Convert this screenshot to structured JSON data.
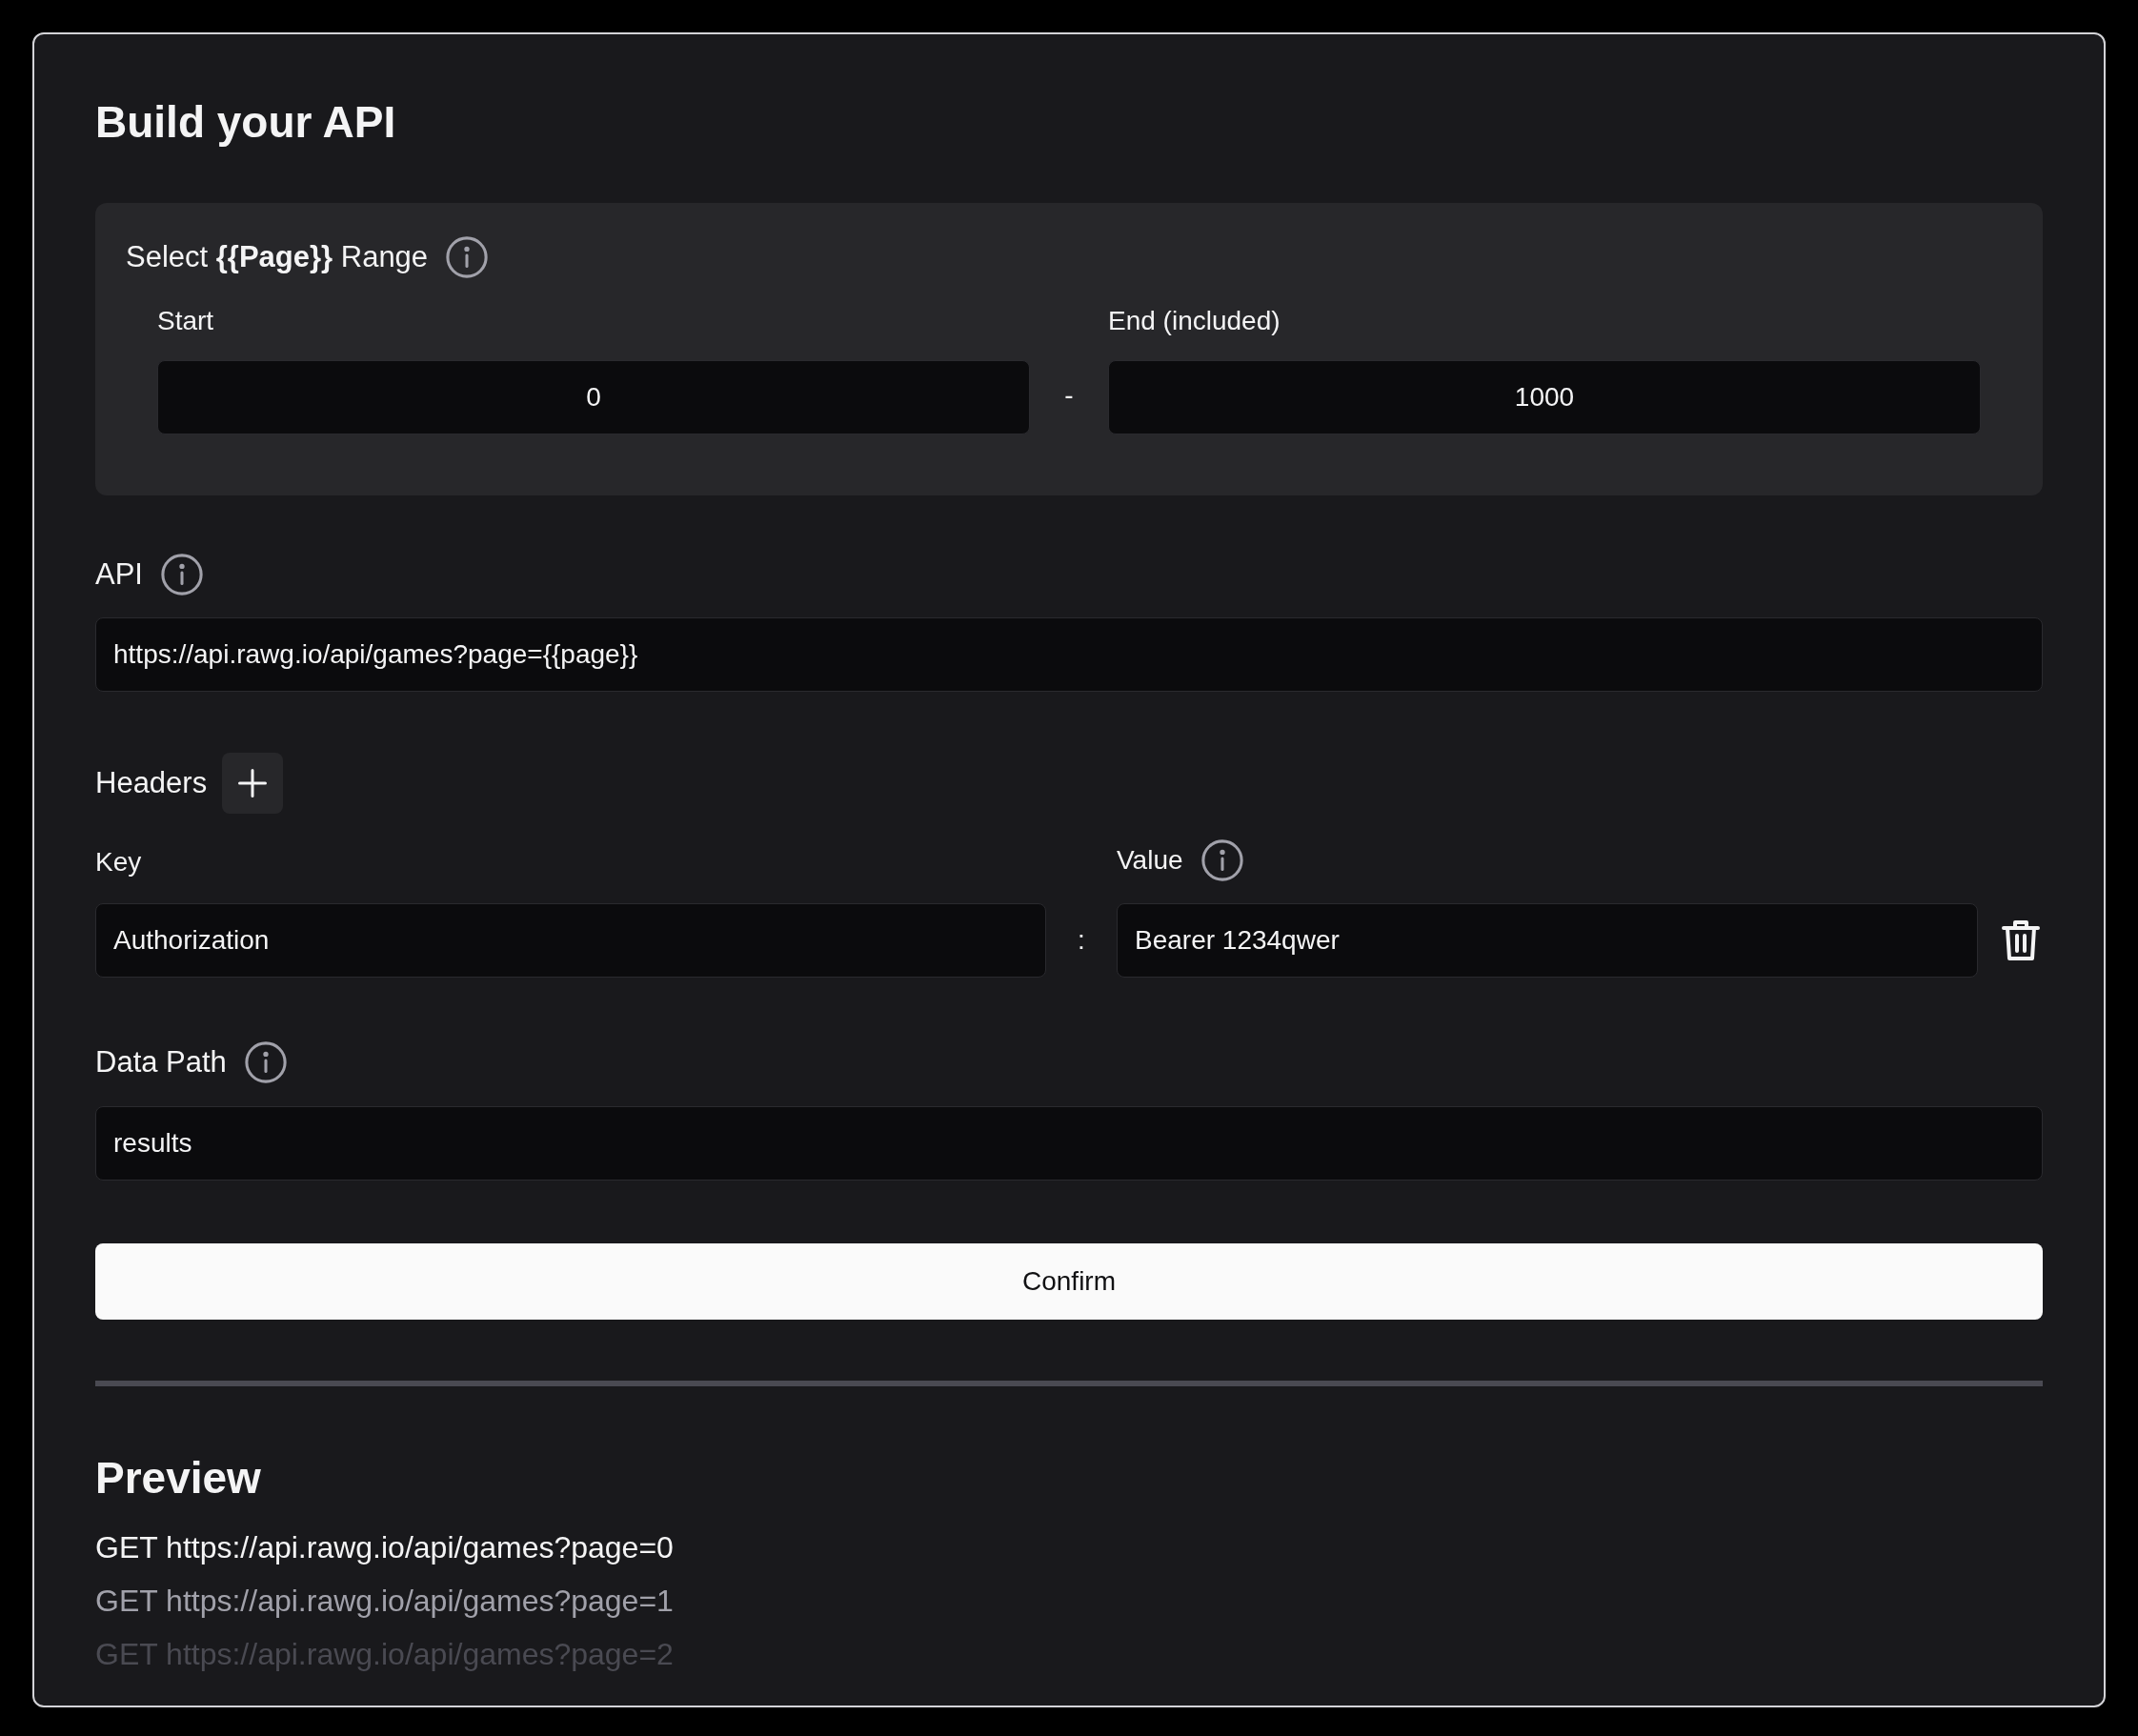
{
  "title": "Build your API",
  "range": {
    "label": "Select **{{Page}}** Range",
    "start_label": "Start",
    "start_value": "0",
    "separator": "-",
    "end_label": "End (included)",
    "end_value": "1000"
  },
  "api": {
    "label": "API",
    "value": "https://api.rawg.io/api/games?page={{page}}"
  },
  "headers": {
    "label": "Headers",
    "key_label": "Key",
    "value_label": "Value",
    "separator": ":",
    "rows": [
      {
        "key": "Authorization",
        "value": "Bearer 1234qwer"
      }
    ]
  },
  "data_path": {
    "label": "Data Path",
    "value": "results"
  },
  "confirm": "Confirm",
  "preview": {
    "title": "Preview",
    "lines": [
      {
        "text": "GET https://api.rawg.io/api/games?page=0",
        "color": "#f4f4f5"
      },
      {
        "text": "GET https://api.rawg.io/api/games?page=1",
        "color": "#a1a1aa"
      },
      {
        "text": "GET https://api.rawg.io/api/games?page=2",
        "color": "#4a4a52"
      }
    ]
  }
}
